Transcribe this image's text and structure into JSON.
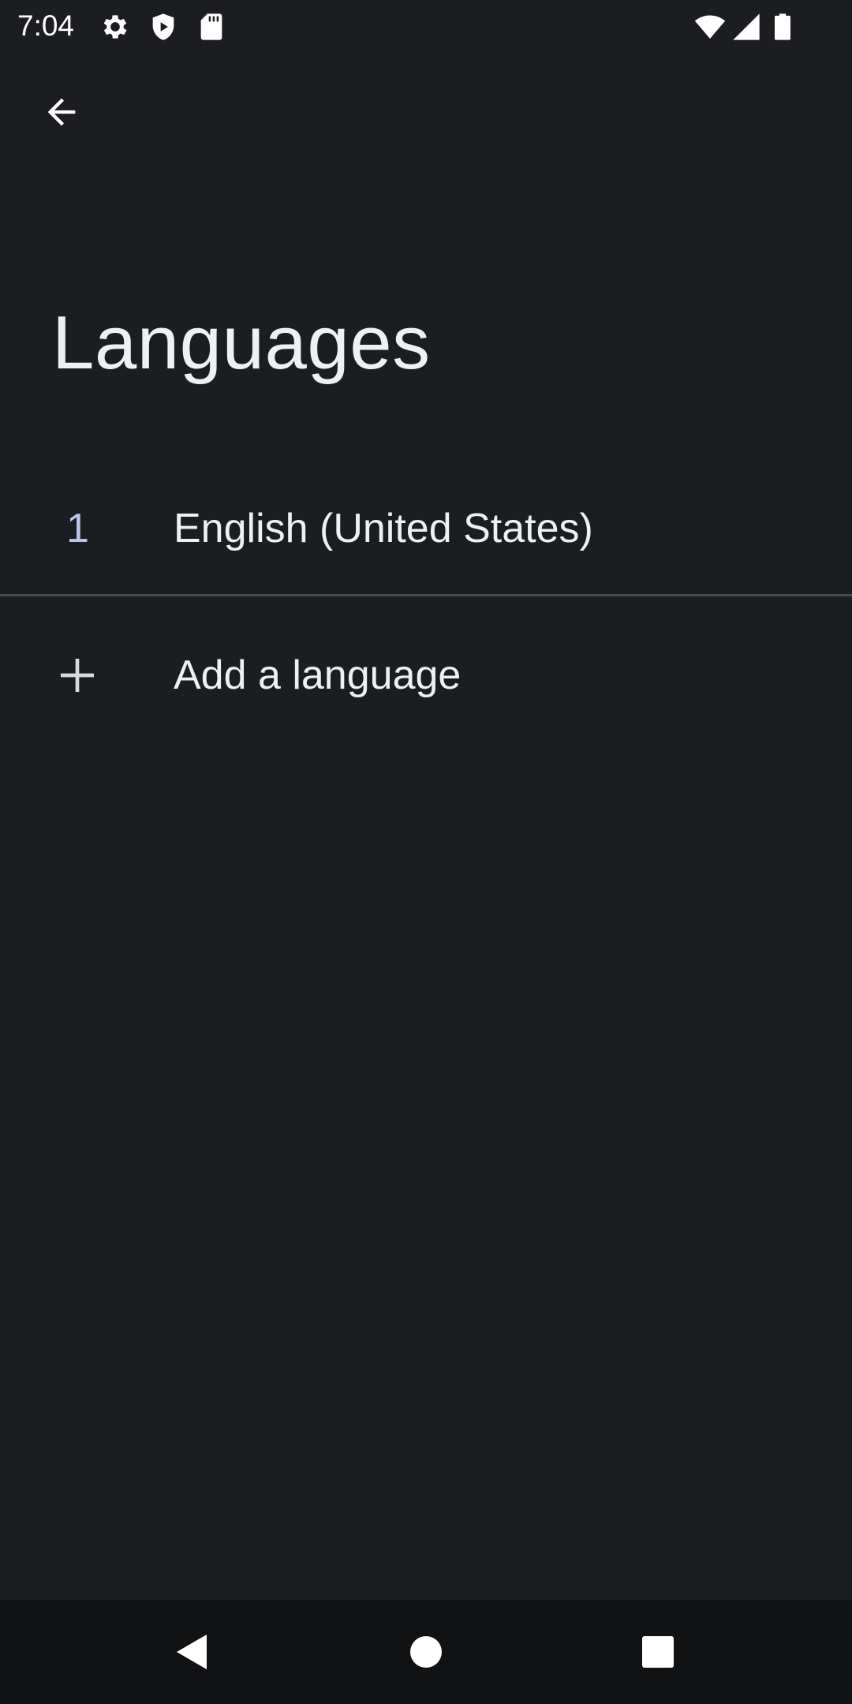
{
  "status_bar": {
    "time": "7:04",
    "left_icons": [
      "gear-icon",
      "shield-play-icon",
      "sd-card-icon"
    ],
    "right_icons": [
      "wifi-icon",
      "cell-signal-icon",
      "battery-icon"
    ]
  },
  "toolbar": {
    "back_icon": "arrow-back-icon"
  },
  "page": {
    "title": "Languages"
  },
  "languages": [
    {
      "number": "1",
      "name": "English (United States)"
    }
  ],
  "add_language": {
    "icon": "plus-icon",
    "label": "Add a language"
  },
  "nav_bar": {
    "buttons": [
      "back-triangle-icon",
      "home-circle-icon",
      "recents-square-icon"
    ]
  },
  "colors": {
    "background": "#1b1d20",
    "nav_background": "#111214",
    "text": "#eef0f3",
    "accent_number": "#b9c7ea",
    "divider": "#45484d"
  }
}
